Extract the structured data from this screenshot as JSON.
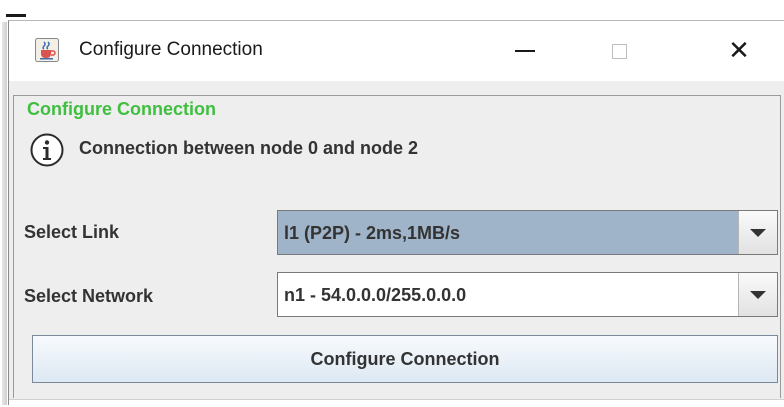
{
  "window": {
    "title": "Configure Connection",
    "controls": {
      "minimize": "minimize",
      "maximize": "maximize",
      "close": "✕"
    }
  },
  "dialog": {
    "group_title": "Configure Connection",
    "info_message": "Connection between node 0 and node 2",
    "fields": [
      {
        "label": "Select Link",
        "value": "l1 (P2P) - 2ms,1MB/s"
      },
      {
        "label": "Select Network",
        "value": "n1 - 54.0.0.0/255.0.0.0"
      }
    ],
    "submit_label": "Configure Connection"
  },
  "colors": {
    "group_title": "#3fbf3f",
    "selected_combo_bg": "#9fb4c8",
    "panel_bg": "#eeeeee"
  },
  "icons": {
    "app": "java-cup-icon",
    "info": "info-icon",
    "dropdown": "chevron-down-icon"
  }
}
